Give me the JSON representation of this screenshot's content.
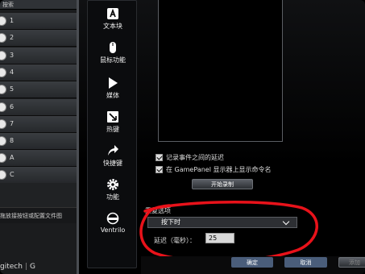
{
  "left_panel": {
    "header": "按索",
    "keys": [
      {
        "label": "1"
      },
      {
        "label": "2"
      },
      {
        "label": "3"
      },
      {
        "label": "4"
      },
      {
        "label": "5"
      },
      {
        "label": "6"
      },
      {
        "label": "7"
      },
      {
        "label": "8"
      },
      {
        "label": "A"
      },
      {
        "label": "C"
      }
    ],
    "note": "拖放接按钮或配置文件图"
  },
  "brand": {
    "name": "gitech",
    "mark": "G"
  },
  "functions": [
    {
      "label": "文本块",
      "icon": "text-block-icon"
    },
    {
      "label": "鼠标功能",
      "icon": "mouse-icon"
    },
    {
      "label": "媒体",
      "icon": "media-play-icon"
    },
    {
      "label": "热键",
      "icon": "hotkey-icon"
    },
    {
      "label": "快捷键",
      "icon": "shortcut-arrow-icon"
    },
    {
      "label": "功能",
      "icon": "gear-icon"
    },
    {
      "label": "Ventrilo",
      "icon": "ventrilo-icon"
    }
  ],
  "options": {
    "record_delay": "记录事件之间的延迟",
    "show_on_gamepanel": "在 GamePanel 显示器上显示命令名",
    "start_record": "开始录制"
  },
  "delay": {
    "label": "重复选项",
    "mode": "按下时",
    "ms_label": "延迟（毫秒）：",
    "ms_value": "25"
  },
  "footer": {
    "ok": "确定",
    "cancel": "取消",
    "add": "添加"
  },
  "colors": {
    "annotation": "#e8121a",
    "button_bar": "#4a5d7a"
  }
}
